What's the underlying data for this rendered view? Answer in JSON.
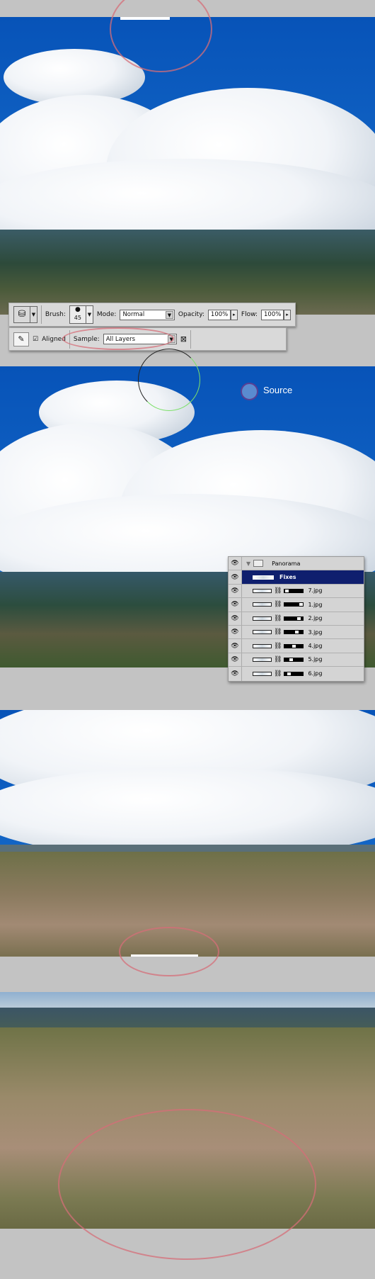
{
  "toolbar": {
    "brush_label": "Brush:",
    "brush_size": "45",
    "mode_label": "Mode:",
    "mode_value": "Normal",
    "opacity_label": "Opacity:",
    "opacity_value": "100%",
    "flow_label": "Flow:",
    "flow_value": "100%",
    "aligned_label": "Aligned",
    "aligned_checked": true,
    "sample_label": "Sample:",
    "sample_value": "All Layers"
  },
  "source_label": "Source",
  "layers": {
    "group": "Panorama",
    "items": [
      {
        "name": "Fixes",
        "selected": true
      },
      {
        "name": "7.jpg"
      },
      {
        "name": "1.jpg"
      },
      {
        "name": "2.jpg"
      },
      {
        "name": "3.jpg"
      },
      {
        "name": "4.jpg"
      },
      {
        "name": "5.jpg"
      },
      {
        "name": "6.jpg"
      }
    ]
  },
  "colors": {
    "selected_layer": "#0f1f6e",
    "sky": "#0a5fc0",
    "highlight_circle": "#d66e78"
  }
}
